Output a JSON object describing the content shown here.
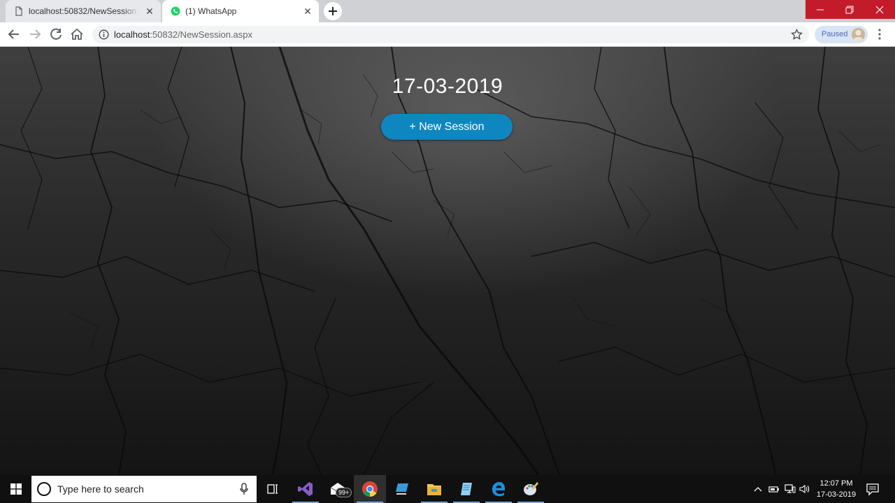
{
  "browser": {
    "tabs": [
      {
        "title": "localhost:50832/NewSession.aspx",
        "active": false,
        "favicon": "page-icon"
      },
      {
        "title": "(1) WhatsApp",
        "active": true,
        "favicon": "whatsapp-icon"
      }
    ],
    "address": {
      "host": "localhost",
      "path": ":50832/NewSession.aspx"
    },
    "profile_status": "Paused"
  },
  "page": {
    "date": "17-03-2019",
    "new_session_label": "+ New Session",
    "accent_color": "#0e87c0"
  },
  "taskbar": {
    "search_placeholder": "Type here to search",
    "mail_badge": "99+",
    "time": "12:07 PM",
    "date": "17-03-2019"
  }
}
